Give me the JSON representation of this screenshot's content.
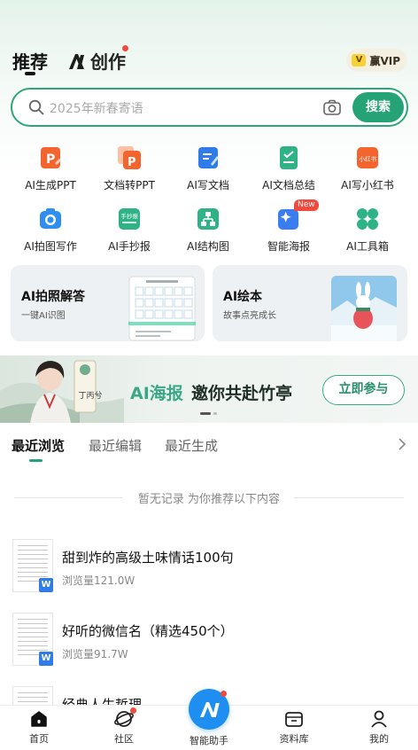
{
  "header": {
    "tab_recommend": "推荐",
    "tab_create": "创作",
    "vip_label": "赢VIP"
  },
  "search": {
    "placeholder": "2025年新春寄语",
    "button": "搜索"
  },
  "tools": [
    {
      "label": "AI生成PPT",
      "icon": "ppt-generate-icon"
    },
    {
      "label": "文档转PPT",
      "icon": "doc-to-ppt-icon"
    },
    {
      "label": "AI写文档",
      "icon": "ai-write-doc-icon"
    },
    {
      "label": "AI文档总结",
      "icon": "doc-summary-icon"
    },
    {
      "label": "AI写小红书",
      "icon": "xiaohongshu-icon"
    },
    {
      "label": "AI拍图写作",
      "icon": "photo-writing-icon"
    },
    {
      "label": "AI手抄报",
      "icon": "handwritten-newspaper-icon"
    },
    {
      "label": "AI结构图",
      "icon": "structure-diagram-icon"
    },
    {
      "label": "智能海报",
      "icon": "smart-poster-icon",
      "badge": "New"
    },
    {
      "label": "AI工具箱",
      "icon": "toolbox-icon"
    }
  ],
  "xiaohongshu_icon_text": "小红书",
  "shouchaobao_icon_text": "手抄报",
  "cards": [
    {
      "title": "AI拍照解答",
      "subtitle": "一键AI识图"
    },
    {
      "title": "AI绘本",
      "subtitle": "故事点亮成长"
    }
  ],
  "banner": {
    "ai_label": "AI海报",
    "text": "邀你共赴竹亭",
    "button": "立即参与",
    "scroll_text": "丁丙兮"
  },
  "recent": {
    "tabs": [
      "最近浏览",
      "最近编辑",
      "最近生成"
    ],
    "empty_text": "暂无记录 为你推荐以下内容"
  },
  "docs": [
    {
      "title": "甜到炸的高级土味情话100句",
      "views": "浏览量121.0W",
      "badge": "W"
    },
    {
      "title": "好听的微信名（精选450个）",
      "views": "浏览量91.7W",
      "badge": "W"
    },
    {
      "title": "经典人生哲理",
      "views": "",
      "badge": ""
    }
  ],
  "nav": [
    {
      "label": "首页",
      "icon": "home-icon"
    },
    {
      "label": "社区",
      "icon": "community-icon"
    },
    {
      "label": "智能助手",
      "icon": "ai-assistant-icon"
    },
    {
      "label": "资料库",
      "icon": "library-icon"
    },
    {
      "label": "我的",
      "icon": "profile-icon"
    }
  ],
  "colors": {
    "accent": "#25a276",
    "ppt_orange": "#f3642e",
    "blue": "#2f7be8",
    "notification_red": "#f04a3e"
  }
}
